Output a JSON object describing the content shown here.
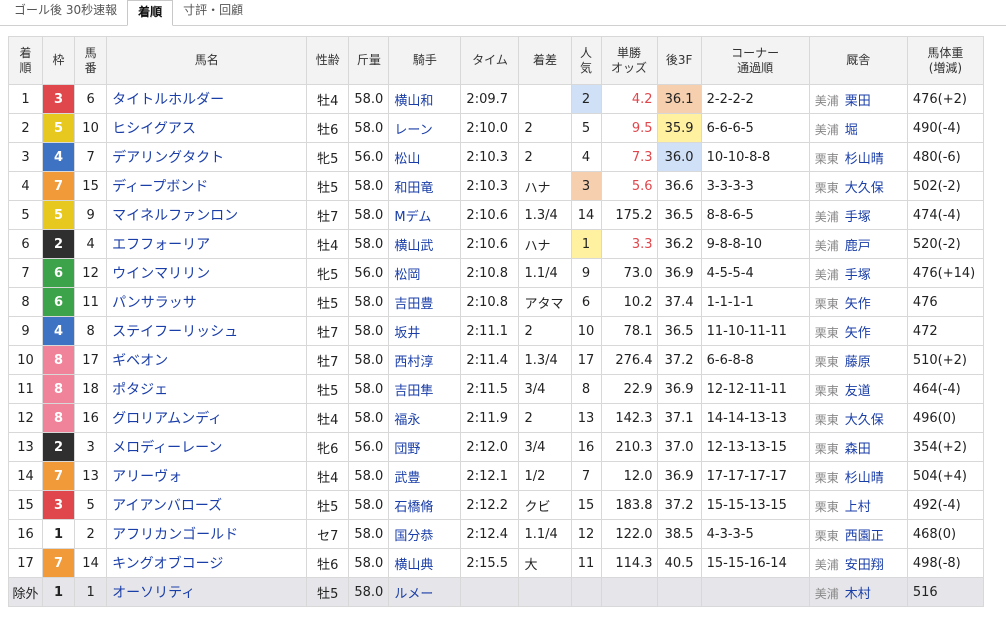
{
  "tabs": [
    {
      "label": "ゴール後 30秒速報",
      "active": false
    },
    {
      "label": "着順",
      "active": true
    },
    {
      "label": "寸評・回顧",
      "active": false
    }
  ],
  "headers": {
    "rank": [
      "着",
      "順"
    ],
    "waku": "枠",
    "num": [
      "馬",
      "番"
    ],
    "name": "馬名",
    "sexage": "性齢",
    "weight": "斤量",
    "jockey": "騎手",
    "time": "タイム",
    "margin": "着差",
    "pop": [
      "人",
      "気"
    ],
    "odds": [
      "単勝",
      "オッズ"
    ],
    "f3": "後3F",
    "corner": [
      "コーナー",
      "通過順"
    ],
    "stable": "厩舎",
    "bw": [
      "馬体重",
      "(増減)"
    ]
  },
  "rows": [
    {
      "rank": "1",
      "waku": "3",
      "num": "6",
      "name": "タイトルホルダー",
      "sexage": "牡4",
      "weight": "58.0",
      "jockey": "横山和",
      "time": "2:09.7",
      "margin": "",
      "pop": "2",
      "odds": "4.2",
      "f3": "36.1",
      "corner": "2-2-2-2",
      "region": "美浦",
      "trainer": "栗田",
      "bw": "476(+2)"
    },
    {
      "rank": "2",
      "waku": "5",
      "num": "10",
      "name": "ヒシイグアス",
      "sexage": "牡6",
      "weight": "58.0",
      "jockey": "レーン",
      "time": "2:10.0",
      "margin": "2",
      "pop": "5",
      "odds": "9.5",
      "f3": "35.9",
      "corner": "6-6-6-5",
      "region": "美浦",
      "trainer": "堀",
      "bw": "490(-4)"
    },
    {
      "rank": "3",
      "waku": "4",
      "num": "7",
      "name": "デアリングタクト",
      "sexage": "牝5",
      "weight": "56.0",
      "jockey": "松山",
      "time": "2:10.3",
      "margin": "2",
      "pop": "4",
      "odds": "7.3",
      "f3": "36.0",
      "corner": "10-10-8-8",
      "region": "栗東",
      "trainer": "杉山晴",
      "bw": "480(-6)"
    },
    {
      "rank": "4",
      "waku": "7",
      "num": "15",
      "name": "ディープボンド",
      "sexage": "牡5",
      "weight": "58.0",
      "jockey": "和田竜",
      "time": "2:10.3",
      "margin": "ハナ",
      "pop": "3",
      "odds": "5.6",
      "f3": "36.6",
      "corner": "3-3-3-3",
      "region": "栗東",
      "trainer": "大久保",
      "bw": "502(-2)"
    },
    {
      "rank": "5",
      "waku": "5",
      "num": "9",
      "name": "マイネルファンロン",
      "sexage": "牡7",
      "weight": "58.0",
      "jockey": "Mデム",
      "time": "2:10.6",
      "margin": "1.3/4",
      "pop": "14",
      "odds": "175.2",
      "f3": "36.5",
      "corner": "8-8-6-5",
      "region": "美浦",
      "trainer": "手塚",
      "bw": "474(-4)"
    },
    {
      "rank": "6",
      "waku": "2",
      "num": "4",
      "name": "エフフォーリア",
      "sexage": "牡4",
      "weight": "58.0",
      "jockey": "横山武",
      "time": "2:10.6",
      "margin": "ハナ",
      "pop": "1",
      "odds": "3.3",
      "f3": "36.2",
      "corner": "9-8-8-10",
      "region": "美浦",
      "trainer": "鹿戸",
      "bw": "520(-2)"
    },
    {
      "rank": "7",
      "waku": "6",
      "num": "12",
      "name": "ウインマリリン",
      "sexage": "牝5",
      "weight": "56.0",
      "jockey": "松岡",
      "time": "2:10.8",
      "margin": "1.1/4",
      "pop": "9",
      "odds": "73.0",
      "f3": "36.9",
      "corner": "4-5-5-4",
      "region": "美浦",
      "trainer": "手塚",
      "bw": "476(+14)"
    },
    {
      "rank": "8",
      "waku": "6",
      "num": "11",
      "name": "パンサラッサ",
      "sexage": "牡5",
      "weight": "58.0",
      "jockey": "吉田豊",
      "time": "2:10.8",
      "margin": "アタマ",
      "pop": "6",
      "odds": "10.2",
      "f3": "37.4",
      "corner": "1-1-1-1",
      "region": "栗東",
      "trainer": "矢作",
      "bw": "476"
    },
    {
      "rank": "9",
      "waku": "4",
      "num": "8",
      "name": "ステイフーリッシュ",
      "sexage": "牡7",
      "weight": "58.0",
      "jockey": "坂井",
      "time": "2:11.1",
      "margin": "2",
      "pop": "10",
      "odds": "78.1",
      "f3": "36.5",
      "corner": "11-10-11-11",
      "region": "栗東",
      "trainer": "矢作",
      "bw": "472"
    },
    {
      "rank": "10",
      "waku": "8",
      "num": "17",
      "name": "ギベオン",
      "sexage": "牡7",
      "weight": "58.0",
      "jockey": "西村淳",
      "time": "2:11.4",
      "margin": "1.3/4",
      "pop": "17",
      "odds": "276.4",
      "f3": "37.2",
      "corner": "6-6-8-8",
      "region": "栗東",
      "trainer": "藤原",
      "bw": "510(+2)"
    },
    {
      "rank": "11",
      "waku": "8",
      "num": "18",
      "name": "ポタジェ",
      "sexage": "牡5",
      "weight": "58.0",
      "jockey": "吉田隼",
      "time": "2:11.5",
      "margin": "3/4",
      "pop": "8",
      "odds": "22.9",
      "f3": "36.9",
      "corner": "12-12-11-11",
      "region": "栗東",
      "trainer": "友道",
      "bw": "464(-4)"
    },
    {
      "rank": "12",
      "waku": "8",
      "num": "16",
      "name": "グロリアムンディ",
      "sexage": "牡4",
      "weight": "58.0",
      "jockey": "福永",
      "time": "2:11.9",
      "margin": "2",
      "pop": "13",
      "odds": "142.3",
      "f3": "37.1",
      "corner": "14-14-13-13",
      "region": "栗東",
      "trainer": "大久保",
      "bw": "496(0)"
    },
    {
      "rank": "13",
      "waku": "2",
      "num": "3",
      "name": "メロディーレーン",
      "sexage": "牝6",
      "weight": "56.0",
      "jockey": "団野",
      "time": "2:12.0",
      "margin": "3/4",
      "pop": "16",
      "odds": "210.3",
      "f3": "37.0",
      "corner": "12-13-13-15",
      "region": "栗東",
      "trainer": "森田",
      "bw": "354(+2)"
    },
    {
      "rank": "14",
      "waku": "7",
      "num": "13",
      "name": "アリーヴォ",
      "sexage": "牡4",
      "weight": "58.0",
      "jockey": "武豊",
      "time": "2:12.1",
      "margin": "1/2",
      "pop": "7",
      "odds": "12.0",
      "f3": "36.9",
      "corner": "17-17-17-17",
      "region": "栗東",
      "trainer": "杉山晴",
      "bw": "504(+4)"
    },
    {
      "rank": "15",
      "waku": "3",
      "num": "5",
      "name": "アイアンバローズ",
      "sexage": "牡5",
      "weight": "58.0",
      "jockey": "石橋脩",
      "time": "2:12.2",
      "margin": "クビ",
      "pop": "15",
      "odds": "183.8",
      "f3": "37.2",
      "corner": "15-15-13-15",
      "region": "栗東",
      "trainer": "上村",
      "bw": "492(-4)"
    },
    {
      "rank": "16",
      "waku": "1",
      "num": "2",
      "name": "アフリカンゴールド",
      "sexage": "セ7",
      "weight": "58.0",
      "jockey": "国分恭",
      "time": "2:12.4",
      "margin": "1.1/4",
      "pop": "12",
      "odds": "122.0",
      "f3": "38.5",
      "corner": "4-3-3-5",
      "region": "栗東",
      "trainer": "西園正",
      "bw": "468(0)"
    },
    {
      "rank": "17",
      "waku": "7",
      "num": "14",
      "name": "キングオブコージ",
      "sexage": "牡6",
      "weight": "58.0",
      "jockey": "横山典",
      "time": "2:15.5",
      "margin": "大",
      "pop": "11",
      "odds": "114.3",
      "f3": "40.5",
      "corner": "15-15-16-14",
      "region": "美浦",
      "trainer": "安田翔",
      "bw": "498(-8)"
    },
    {
      "rank": "除外",
      "waku": "1",
      "num": "1",
      "name": "オーソリティ",
      "sexage": "牡5",
      "weight": "58.0",
      "jockey": "ルメー",
      "time": "",
      "margin": "",
      "pop": "",
      "odds": "",
      "f3": "",
      "corner": "",
      "region": "美浦",
      "trainer": "木村",
      "bw": "516",
      "scratch": true
    }
  ],
  "highlight_colors": {
    "first": "#fff1a0",
    "second": "#cfe0f7",
    "third": "#f5cfae"
  }
}
